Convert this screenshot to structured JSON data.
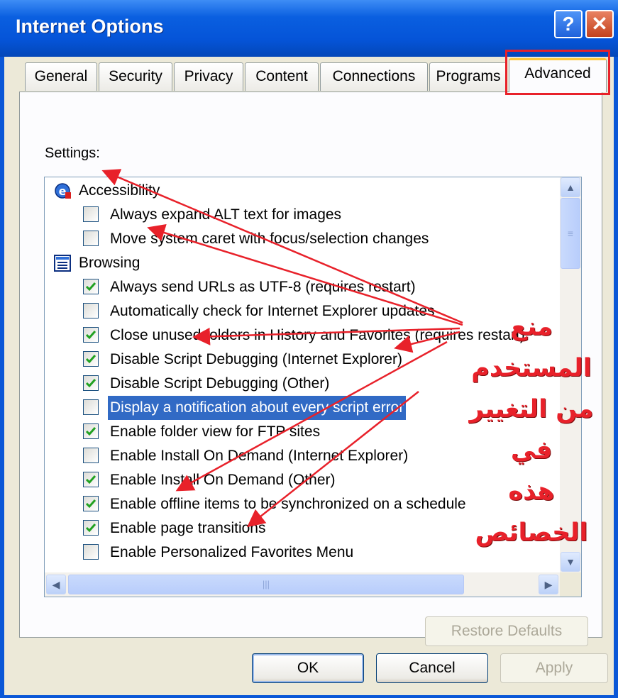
{
  "window": {
    "title": "Internet Options",
    "help_label": "?",
    "close_label": "✕"
  },
  "tabs": [
    {
      "label": "General",
      "active": false
    },
    {
      "label": "Security",
      "active": false
    },
    {
      "label": "Privacy",
      "active": false
    },
    {
      "label": "Content",
      "active": false
    },
    {
      "label": "Connections",
      "active": false
    },
    {
      "label": "Programs",
      "active": false
    },
    {
      "label": "Advanced",
      "active": true
    }
  ],
  "settings": {
    "label": "Settings:",
    "categories": [
      {
        "label": "Accessibility",
        "icon": "accessibility-icon"
      },
      {
        "label": "Browsing",
        "icon": "browsing-icon"
      }
    ],
    "items": [
      {
        "label": "Always expand ALT text for images",
        "checked": false,
        "selected": false
      },
      {
        "label": "Move system caret with focus/selection changes",
        "checked": false,
        "selected": false
      },
      {
        "label": "Always send URLs as UTF-8 (requires restart)",
        "checked": true,
        "selected": false
      },
      {
        "label": "Automatically check for Internet Explorer updates",
        "checked": false,
        "selected": false
      },
      {
        "label": "Close unused folders in History and Favorites (requires restart)",
        "checked": true,
        "selected": false
      },
      {
        "label": "Disable Script Debugging (Internet Explorer)",
        "checked": true,
        "selected": false
      },
      {
        "label": "Disable Script Debugging (Other)",
        "checked": true,
        "selected": false
      },
      {
        "label": "Display a notification about every script error",
        "checked": false,
        "selected": true
      },
      {
        "label": "Enable folder view for FTP sites",
        "checked": true,
        "selected": false
      },
      {
        "label": "Enable Install On Demand (Internet Explorer)",
        "checked": false,
        "selected": false
      },
      {
        "label": "Enable Install On Demand (Other)",
        "checked": true,
        "selected": false
      },
      {
        "label": "Enable offline items to be synchronized on a schedule",
        "checked": true,
        "selected": false
      },
      {
        "label": "Enable page transitions",
        "checked": true,
        "selected": false
      },
      {
        "label": "Enable Personalized Favorites Menu",
        "checked": false,
        "selected": false
      }
    ]
  },
  "buttons": {
    "restore_defaults": "Restore Defaults",
    "ok": "OK",
    "cancel": "Cancel",
    "apply": "Apply"
  },
  "annotation": {
    "lines": [
      "منع المستخدم",
      "من التغيير في",
      "هذه",
      "الخصائص"
    ],
    "color": "#e8212a"
  },
  "colors": {
    "titlebar": "#0554d8",
    "dialog_bg": "#ece9d8",
    "selection": "#316ac5",
    "checkmark": "#21a121",
    "highlight_box": "#e8212a"
  }
}
